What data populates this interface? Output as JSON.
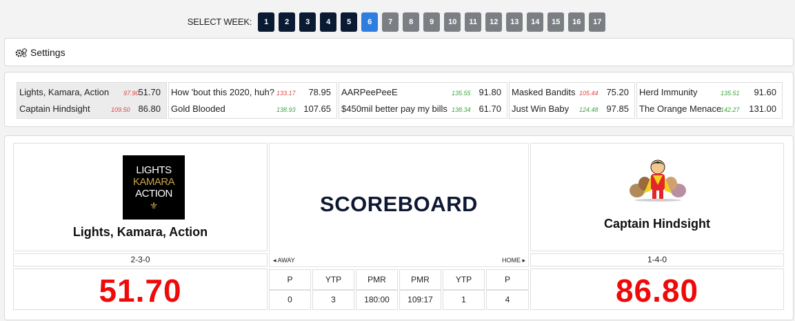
{
  "week_selector": {
    "label": "SELECT WEEK:",
    "weeks": [
      "1",
      "2",
      "3",
      "4",
      "5",
      "6",
      "7",
      "8",
      "9",
      "10",
      "11",
      "12",
      "13",
      "14",
      "15",
      "16",
      "17"
    ],
    "current_week": "6"
  },
  "settings": {
    "label": "Settings",
    "icon": "gears-icon"
  },
  "matchups": [
    {
      "team1": "Lights, Kamara, Action",
      "proj1": "97.90",
      "score1": "51.70",
      "team2": "Captain Hindsight",
      "proj2": "109.50",
      "score2": "86.80"
    },
    {
      "team1": "How 'bout this 2020, huh?",
      "proj1": "133.17",
      "score1": "78.95",
      "team2": "Gold Blooded",
      "proj2": "138.93",
      "score2": "107.65"
    },
    {
      "team1": "AARPeePeeE",
      "proj1": "135.55",
      "score1": "91.80",
      "team2": "$450mil better pay my bills",
      "proj2": "138.34",
      "score2": "61.70"
    },
    {
      "team1": "Masked Bandits",
      "proj1": "105.44",
      "score1": "75.20",
      "team2": "Just Win Baby",
      "proj2": "124.48",
      "score2": "97.85"
    },
    {
      "team1": "Herd Immunity",
      "proj1": "135.51",
      "score1": "91.60",
      "team2": "The Orange Menace",
      "proj2": "142.27",
      "score2": "131.00"
    }
  ],
  "scoreboard": {
    "title": "SCOREBOARD",
    "away_label": "AWAY",
    "home_label": "HOME",
    "away": {
      "name": "Lights, Kamara, Action",
      "logo_text": [
        "LIGHTS",
        "KAMARA",
        "ACTION"
      ],
      "record": "2-3-0",
      "score": "51.70"
    },
    "home": {
      "name": "Captain Hindsight",
      "record": "1-4-0",
      "score": "86.80"
    },
    "stat_headers": [
      "P",
      "YTP",
      "PMR",
      "PMR",
      "YTP",
      "P"
    ],
    "stat_values": [
      "0",
      "3",
      "180:00",
      "109:17",
      "1",
      "4"
    ]
  },
  "colors": {
    "week_past": "#0a1a33",
    "week_current": "#2f7de1",
    "week_future": "#7b7f84",
    "score_red": "#ee0a0a",
    "proj_red": "#e04545",
    "proj_green": "#3ea33e"
  }
}
